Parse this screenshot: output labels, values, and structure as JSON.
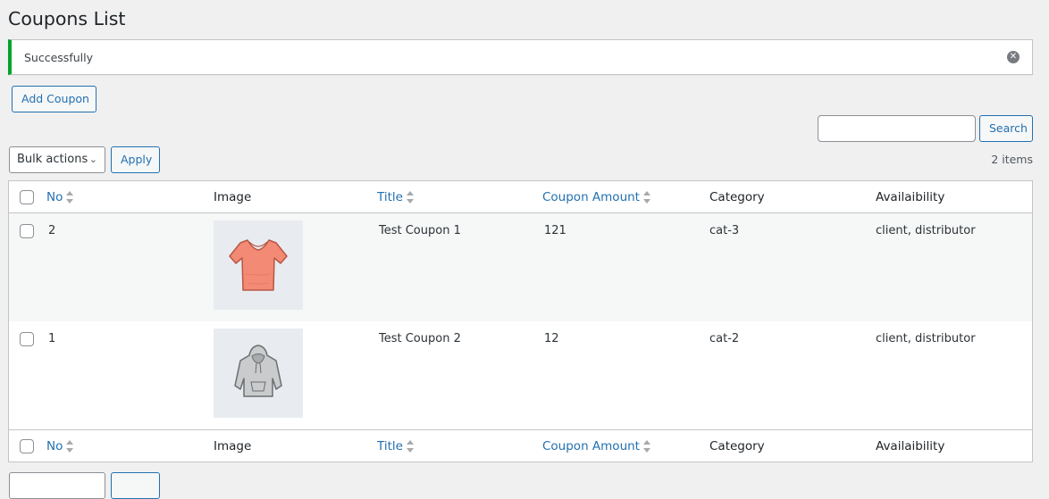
{
  "page": {
    "title": "Coupons List"
  },
  "notice": {
    "message": "Successfully"
  },
  "toolbar": {
    "add_label": "Add Coupon",
    "search_placeholder": "",
    "search_label": "Search",
    "bulk_label": "Bulk actions",
    "apply_label": "Apply",
    "items_count": "2 items"
  },
  "table": {
    "columns": [
      "No",
      "Image",
      "Title",
      "Coupon Amount",
      "Category",
      "Availaibility"
    ],
    "rows": [
      {
        "no": "2",
        "image": "tshirt-icon",
        "title": "Test Coupon 1",
        "amount": "121",
        "category": "cat-3",
        "availability": "client, distributor"
      },
      {
        "no": "1",
        "image": "hoodie-icon",
        "title": "Test Coupon 2",
        "amount": "12",
        "category": "cat-2",
        "availability": "client, distributor"
      }
    ]
  },
  "colors": {
    "accent": "#2271b1",
    "success": "#00a32a"
  }
}
